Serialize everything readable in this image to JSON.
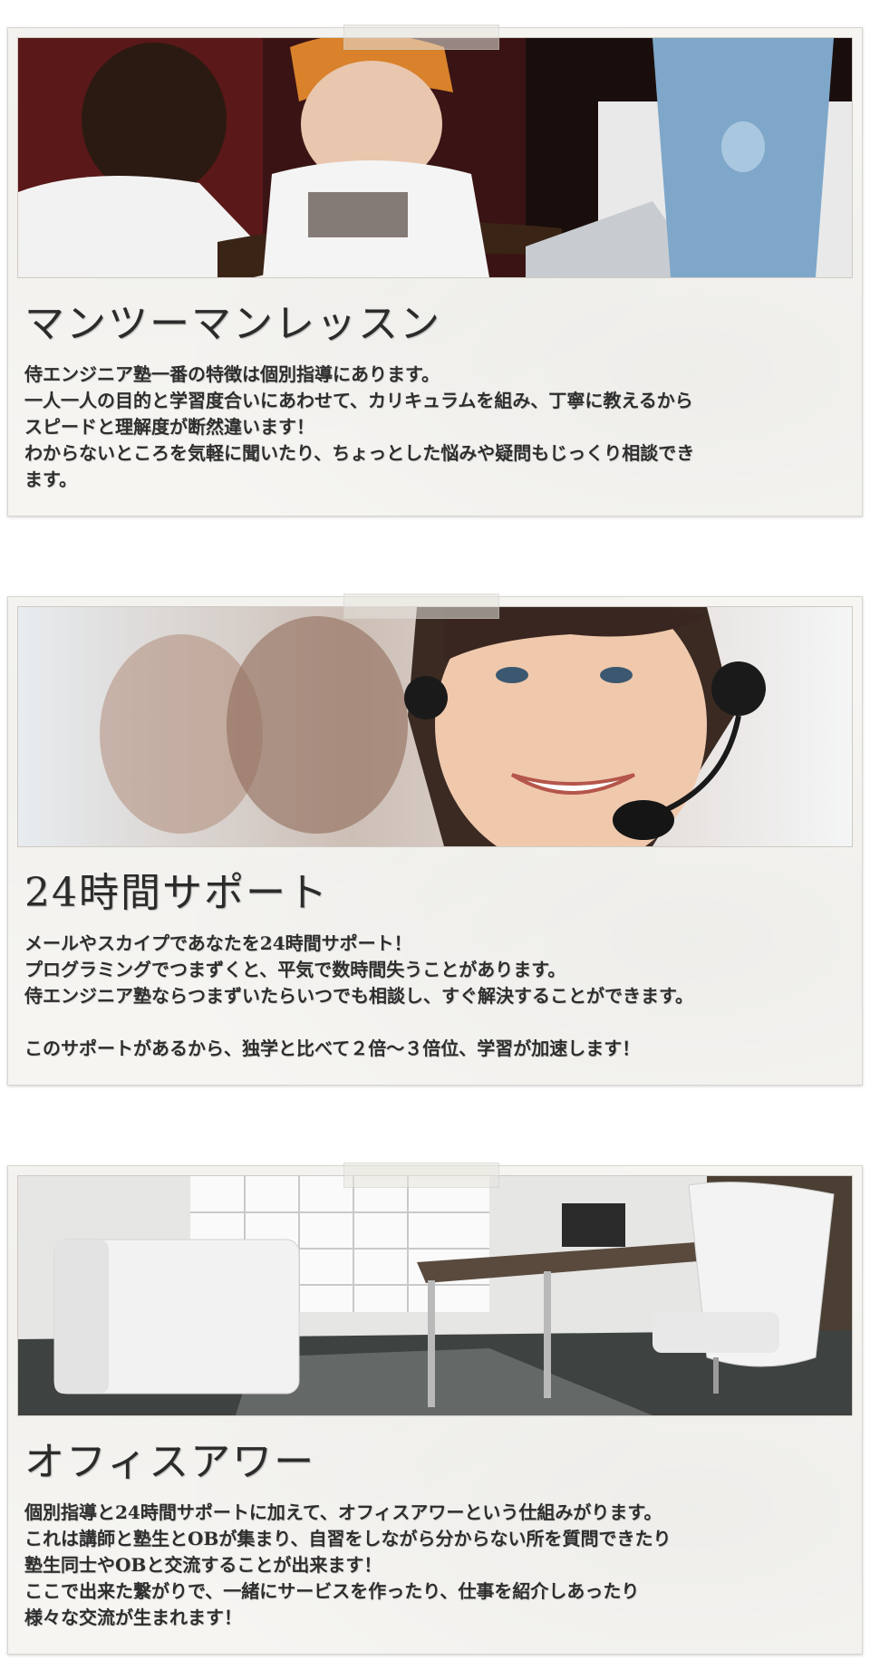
{
  "sections": [
    {
      "image": "children-at-laptop-photo",
      "heading": "マンツーマンレッスン",
      "lines": [
        "侍エンジニア塾一番の特徴は個別指導にあります。",
        "一人一人の目的と学習度合いにあわせて、カリキュラムを組み、丁寧に教えるから",
        "スピードと理解度が断然違います！",
        "わからないところを気軽に聞いたり、ちょっとした悩みや疑問もじっくり相談でき",
        "ます。"
      ]
    },
    {
      "image": "headset-support-woman-photo",
      "heading": "24時間サポート",
      "lines": [
        "メールやスカイプであなたを24時間サポート！",
        "プログラミングでつまずくと、平気で数時間失うことがあります。",
        "侍エンジニア塾ならつまずいたらいつでも相談し、すぐ解決することができます。",
        "",
        "このサポートがあるから、独学と比べて２倍〜３倍位、学習が加速します！"
      ]
    },
    {
      "image": "office-room-photo",
      "heading": "オフィスアワー",
      "lines": [
        "個別指導と24時間サポートに加えて、オフィスアワーという仕組みがります。",
        "これは講師と塾生とOBが集まり、自習をしながら分からない所を質問できたり",
        "塾生同士やOBと交流することが出来ます！",
        "ここで出来た繋がりで、一緒にサービスを作ったり、仕事を紹介しあったり",
        "様々な交流が生まれます！"
      ]
    }
  ]
}
